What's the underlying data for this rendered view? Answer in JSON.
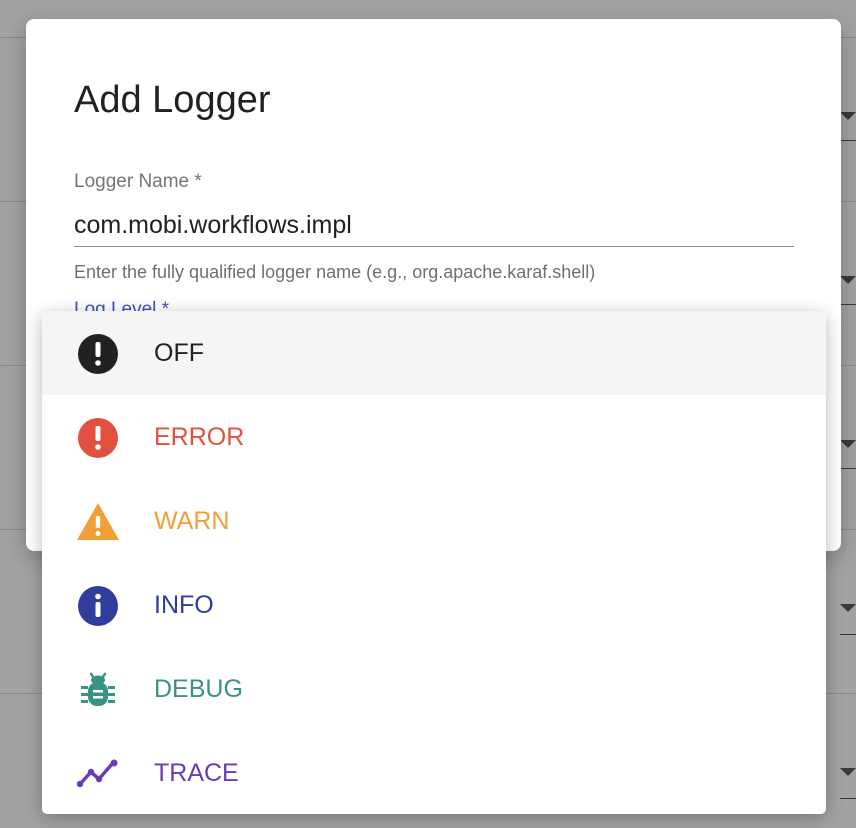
{
  "dialog": {
    "title": "Add Logger",
    "logger_name": {
      "label": "Logger Name *",
      "value": "com.mobi.workflows.impl",
      "hint": "Enter the fully qualified logger name (e.g., org.apache.karaf.shell)"
    },
    "log_level": {
      "label": "Log Level *"
    }
  },
  "menu": {
    "items": [
      {
        "label": "OFF",
        "icon": "exclamation-circle-icon",
        "color": "#212121",
        "selected": true
      },
      {
        "label": "ERROR",
        "icon": "exclamation-circle-icon",
        "color": "#e0523f",
        "selected": false
      },
      {
        "label": "WARN",
        "icon": "warning-triangle-icon",
        "color": "#f29f38",
        "selected": false
      },
      {
        "label": "INFO",
        "icon": "info-circle-icon",
        "color": "#2f3e9e",
        "selected": false
      },
      {
        "label": "DEBUG",
        "icon": "bug-icon",
        "color": "#3a9287",
        "selected": false
      },
      {
        "label": "TRACE",
        "icon": "trending-line-icon",
        "color": "#6a3bb2",
        "selected": false
      }
    ]
  }
}
